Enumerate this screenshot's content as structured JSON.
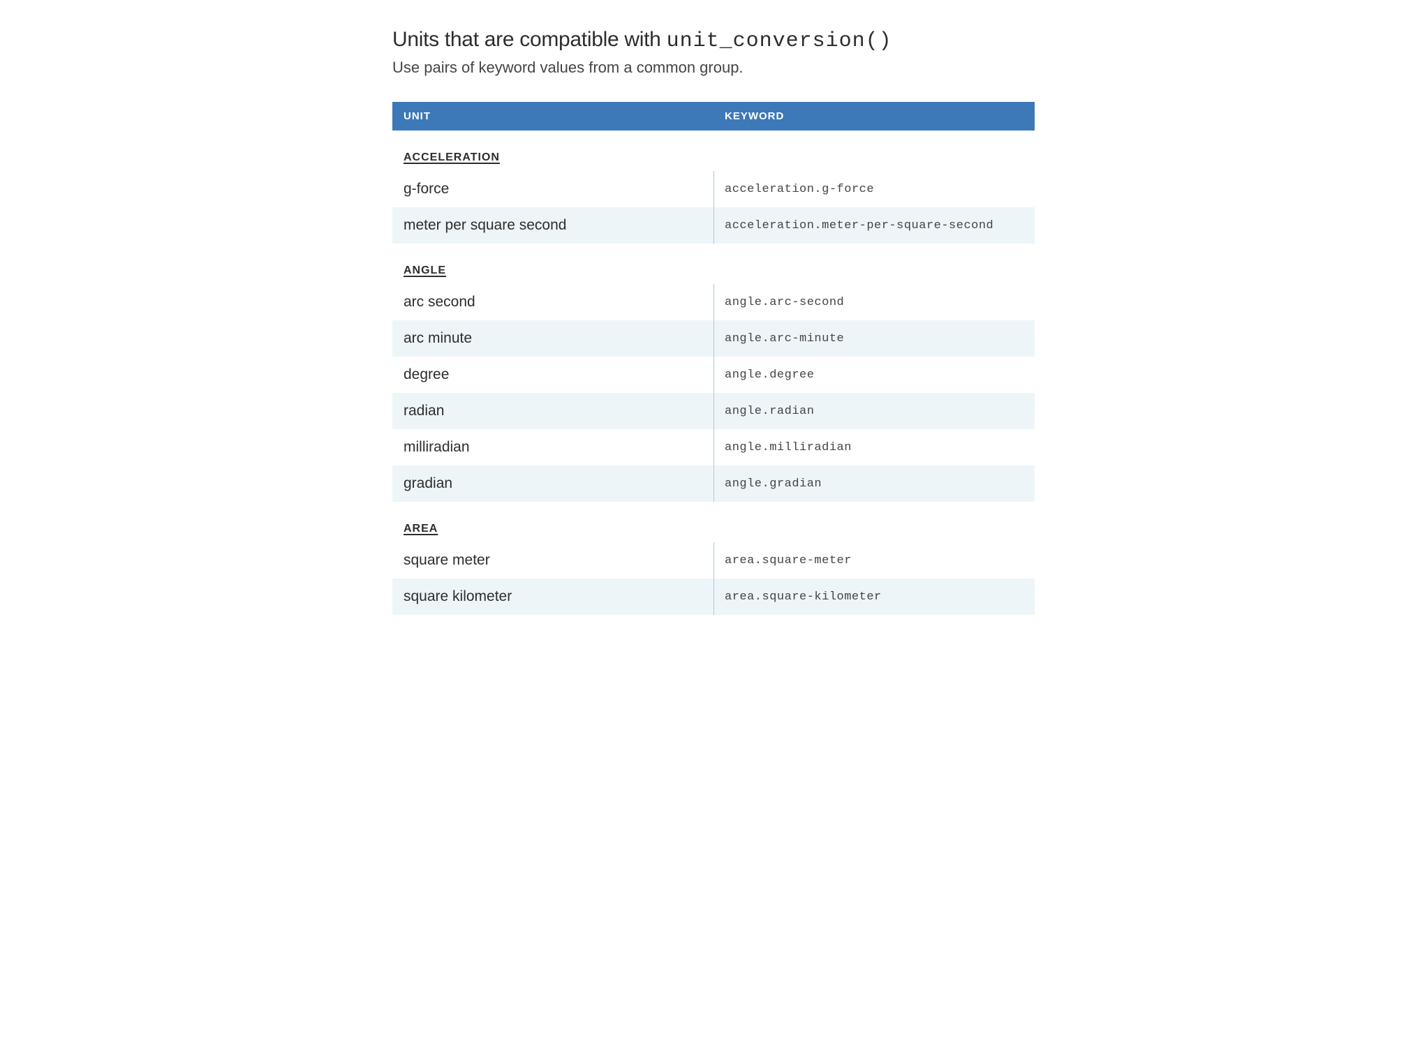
{
  "heading": {
    "prefix": "Units that are compatible with ",
    "code": "unit_conversion()"
  },
  "subtitle": "Use pairs of keyword values from a common group.",
  "columns": {
    "unit": "UNIT",
    "keyword": "KEYWORD"
  },
  "groups": [
    {
      "name": "ACCELERATION",
      "rows": [
        {
          "unit": "g-force",
          "keyword": "acceleration.g-force"
        },
        {
          "unit": "meter per square second",
          "keyword": "acceleration.meter-per-square-second"
        }
      ]
    },
    {
      "name": "ANGLE",
      "rows": [
        {
          "unit": "arc second",
          "keyword": "angle.arc-second"
        },
        {
          "unit": "arc minute",
          "keyword": "angle.arc-minute"
        },
        {
          "unit": "degree",
          "keyword": "angle.degree"
        },
        {
          "unit": "radian",
          "keyword": "angle.radian"
        },
        {
          "unit": "milliradian",
          "keyword": "angle.milliradian"
        },
        {
          "unit": "gradian",
          "keyword": "angle.gradian"
        }
      ]
    },
    {
      "name": "AREA",
      "rows": [
        {
          "unit": "square meter",
          "keyword": "area.square-meter"
        },
        {
          "unit": "square kilometer",
          "keyword": "area.square-kilometer"
        }
      ]
    }
  ]
}
